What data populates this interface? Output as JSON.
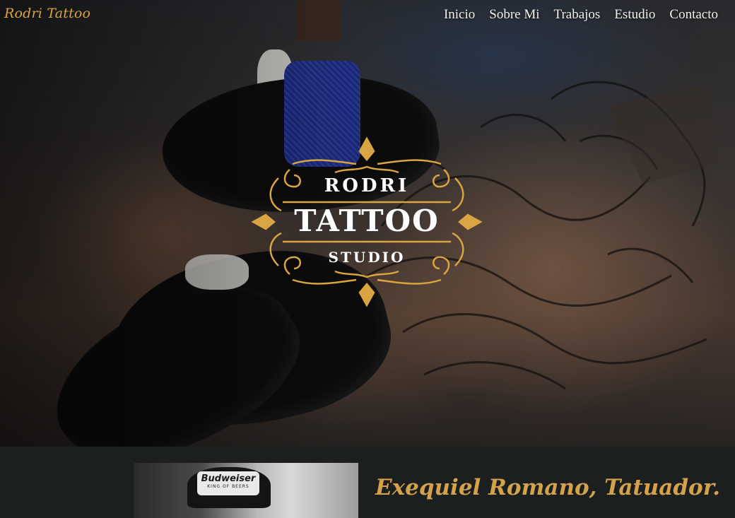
{
  "header": {
    "brand": "Rodri Tattoo",
    "nav": [
      {
        "label": "Inicio"
      },
      {
        "label": "Sobre Mi"
      },
      {
        "label": "Trabajos"
      },
      {
        "label": "Estudio"
      },
      {
        "label": "Contacto"
      }
    ]
  },
  "hero": {
    "logo": {
      "line1": "RODRI",
      "line2": "TATTOO",
      "line3": "STUDIO"
    }
  },
  "about": {
    "photo_cap_text": "Budweiser",
    "photo_cap_subtext": "KING OF BEERS",
    "title": "Exequiel Romano, Tatuador."
  },
  "colors": {
    "accent": "#d9a441",
    "nav_text": "#f3f0ea",
    "section_bg": "#1c1f1f"
  },
  "icons": [
    "ornamental-frame-icon"
  ]
}
